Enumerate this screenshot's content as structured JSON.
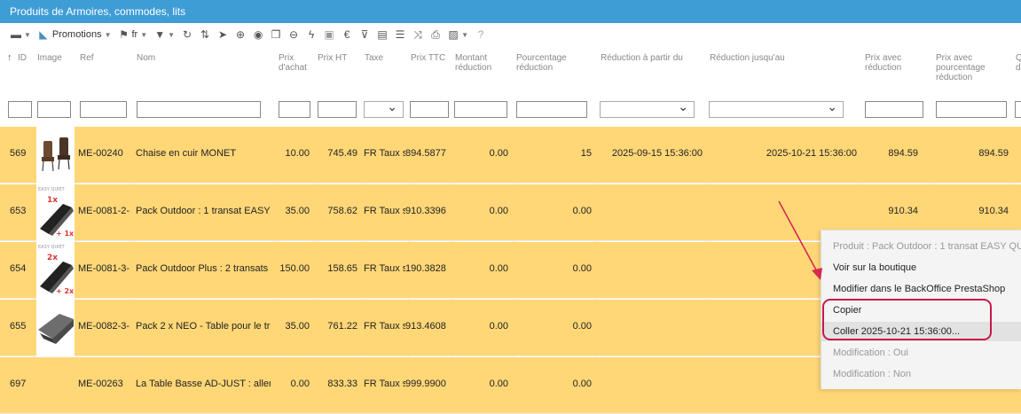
{
  "window": {
    "title": "Produits de Armoires, commodes, lits"
  },
  "toolbar": {
    "promotions_label": "Promotions",
    "lang_label": "fr",
    "icons": [
      "save-icon",
      "discount-icon",
      "flag-icon",
      "filter-icon",
      "refresh-icon",
      "columns-icon",
      "pointer-icon",
      "add-icon",
      "duplicate-icon",
      "copy-icon",
      "remove-icon",
      "lightning-icon",
      "folder-icon",
      "euro-icon",
      "filter-clear-icon",
      "csv-icon",
      "list-icon",
      "shuffle-icon",
      "print-icon",
      "image-icon",
      "help-icon"
    ]
  },
  "columns": [
    "ID",
    "Image",
    "Ref",
    "Nom",
    "Prix d'achat",
    "Prix HT",
    "Taxe",
    "Prix TTC",
    "Montant réduction",
    "Pourcentage réduction",
    "Réduction à partir du",
    "Réduction jusqu'au",
    "Prix avec réduction",
    "Prix avec pourcentage réduction",
    "Q d"
  ],
  "sort_arrow": "↑",
  "rows": [
    {
      "id": "569",
      "ref": "ME-00240",
      "nom": "Chaise en cuir MONET",
      "achat": "10.00",
      "ht": "745.49",
      "taxe": "FR Taux s",
      "ttc": "894.5877",
      "montant": "0.00",
      "pourcentage": "15",
      "from": "2025-09-15 15:36:00",
      "to": "2025-10-21 15:36:00",
      "prix_red": "894.59",
      "prix_pct": "894.59",
      "thumb": "chair"
    },
    {
      "id": "653",
      "ref": "ME-0081-2-",
      "nom": "Pack Outdoor : 1 transat EASY",
      "achat": "35.00",
      "ht": "758.62",
      "taxe": "FR Taux s",
      "ttc": "910.3396",
      "montant": "0.00",
      "pourcentage": "0.00",
      "from": "",
      "to": "",
      "prix_red": "910.34",
      "prix_pct": "910.34",
      "thumb": "easy1",
      "thumb_brand": "EASY QUIET",
      "thumb_top": "1x",
      "thumb_bottom": "+ 1x"
    },
    {
      "id": "654",
      "ref": "ME-0081-3-",
      "nom": "Pack Outdoor Plus : 2 transats",
      "achat": "150.00",
      "ht": "158.65",
      "taxe": "FR Taux s",
      "ttc": "190.3828",
      "montant": "0.00",
      "pourcentage": "0.00",
      "from": "",
      "to": "",
      "prix_red": "",
      "prix_pct": "",
      "thumb": "easy2",
      "thumb_brand": "EASY QUIET",
      "thumb_top": "2x",
      "thumb_bottom": "+ 2x"
    },
    {
      "id": "655",
      "ref": "ME-0082-3-",
      "nom": "Pack 2 x NEO - Table pour le tr",
      "achat": "35.00",
      "ht": "761.22",
      "taxe": "FR Taux s",
      "ttc": "913.4608",
      "montant": "0.00",
      "pourcentage": "0.00",
      "from": "",
      "to": "",
      "prix_red": "",
      "prix_pct": "",
      "thumb": "neo"
    },
    {
      "id": "697",
      "ref": "ME-00263",
      "nom": "La Table Basse AD-JUST : aller",
      "achat": "0.00",
      "ht": "833.33",
      "taxe": "FR Taux s",
      "ttc": "999.9900",
      "montant": "0.00",
      "pourcentage": "0.00",
      "from": "",
      "to": "",
      "prix_red": "",
      "prix_pct": "",
      "thumb": "none"
    }
  ],
  "context_menu": {
    "header": "Produit : Pack Outdoor : 1 transat EASY QU",
    "items": [
      {
        "label": "Voir sur la boutique",
        "enabled": true
      },
      {
        "label": "Modifier dans le BackOffice PrestaShop",
        "enabled": true
      },
      {
        "label": "Copier",
        "enabled": true
      },
      {
        "label": "Coller 2025-10-21 15:36:00...",
        "enabled": true,
        "highlighted": true
      },
      {
        "label": "Modification : Oui",
        "enabled": false
      },
      {
        "label": "Modification : Non",
        "enabled": false
      }
    ]
  },
  "annotation_color": "#c8184a"
}
